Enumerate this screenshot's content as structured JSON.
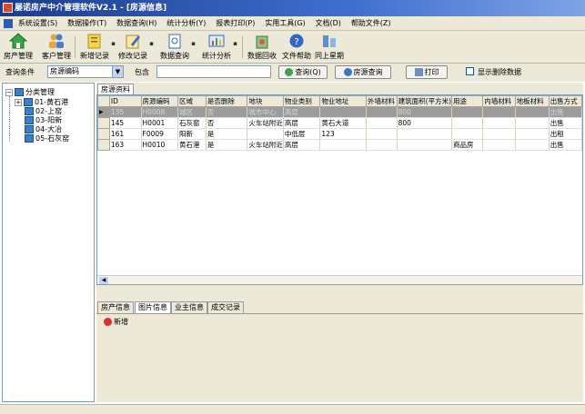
{
  "window": {
    "title": "屡诺房产中介管理软件V2.1 - [房源信息]"
  },
  "menubar": [
    "系统设置(S)",
    "数据操作(T)",
    "数据查询(H)",
    "统计分析(Y)",
    "报表打印(P)",
    "实用工具(G)",
    "文档(D)",
    "帮助文件(Z)"
  ],
  "toolbar": {
    "property": "房产管理",
    "customer": "客户管理",
    "add": "新增记录",
    "edit": "修改记录",
    "query": "数据查询",
    "stats": "统计分析",
    "recycle": "数据回收",
    "help": "文件帮助",
    "sync": "同上星期"
  },
  "query": {
    "condition_label": "查询条件",
    "field_value": "房源编码",
    "contains_label": "包含",
    "search_btn": "查询(Q)",
    "house_query_btn": "房源查询",
    "print_btn": "打印",
    "show_deleted_label": "显示删除数据"
  },
  "tree": {
    "root": "分类管理",
    "children": [
      "01-黄石港",
      "02-上窑",
      "03-阳新",
      "04-大冶",
      "05-石灰窑"
    ]
  },
  "grid": {
    "tab": "房源资料",
    "columns": [
      "ID",
      "房源编码",
      "区域",
      "是否删除",
      "地块",
      "物业类别",
      "物业地址",
      "外墙材料",
      "建筑面积(平方米)",
      "用途",
      "内墙材料",
      "地板材料",
      "出售方式"
    ],
    "rows": [
      [
        "135",
        "H0008",
        "城区",
        "否",
        "城市中心",
        "高层",
        "",
        "",
        "800",
        "",
        "",
        "",
        "出售"
      ],
      [
        "145",
        "H0001",
        "石灰窑",
        "否",
        "火车站附近",
        "高层",
        "黄石大道",
        "",
        "800",
        "",
        "",
        "",
        "出售"
      ],
      [
        "161",
        "F0009",
        "阳新",
        "是",
        "",
        "中低层",
        "123",
        "",
        "",
        "",
        "",
        "",
        "出租"
      ],
      [
        "163",
        "H0010",
        "黄石港",
        "是",
        "火车站附近",
        "高层",
        "",
        "",
        "",
        "商品房",
        "",
        "",
        "出售"
      ]
    ]
  },
  "subtabs": [
    "房产信息",
    "图片信息",
    "业主信息",
    "成交记录"
  ],
  "subpanel": {
    "add_label": "新增"
  }
}
